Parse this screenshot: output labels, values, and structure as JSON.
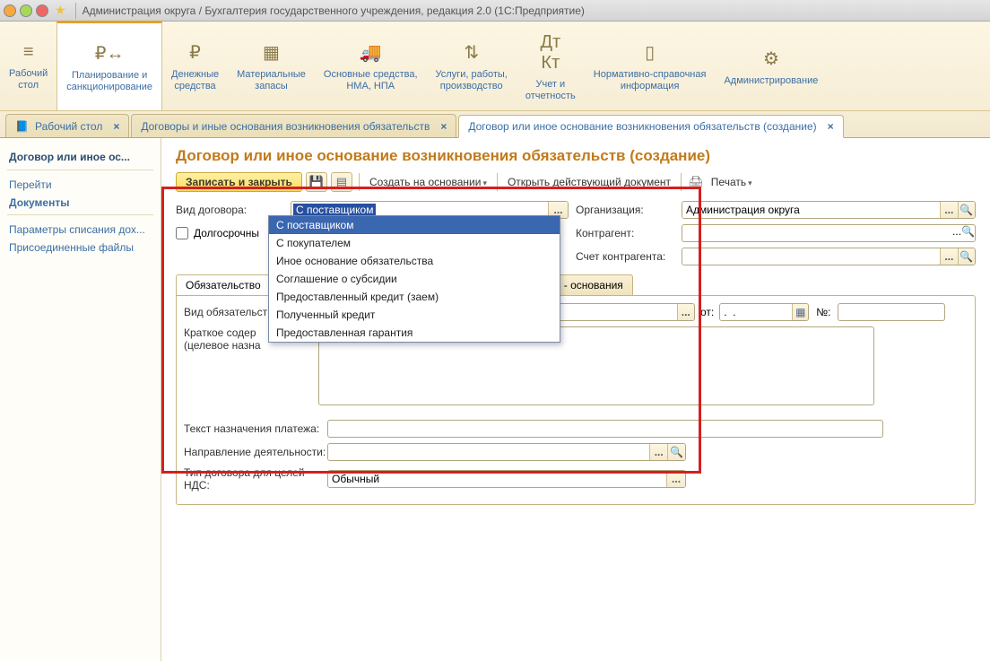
{
  "window": {
    "title": "Администрация округа / Бухгалтерия государственного учреждения, редакция 2.0  (1С:Предприятие)"
  },
  "toolbar": {
    "items": [
      {
        "label": "Рабочий\nстол"
      },
      {
        "label": "Планирование и\nсанкционирование"
      },
      {
        "label": "Денежные\nсредства"
      },
      {
        "label": "Материальные\nзапасы"
      },
      {
        "label": "Основные средства,\nНМА, НПА"
      },
      {
        "label": "Услуги, работы,\nпроизводство"
      },
      {
        "label": "Учет и\nотчетность"
      },
      {
        "label": "Нормативно-справочная\nинформация"
      },
      {
        "label": "Администрирование"
      }
    ]
  },
  "tabs": {
    "t0": "Рабочий стол",
    "t1": "Договоры и иные основания возникновения обязательств",
    "t2": "Договор или иное основание возникновения обязательств (создание)"
  },
  "sidebar": {
    "group_title": "Договор или иное ос...",
    "nav_goto": "Перейти",
    "nav_docs": "Документы",
    "link1": "Параметры списания дох...",
    "link2": "Присоединенные файлы"
  },
  "page": {
    "title": "Договор или иное основание возникновения обязательств (создание)",
    "actions": {
      "save_close": "Записать и закрыть",
      "create_based": "Создать на основании",
      "open_current": "Открыть действующий документ",
      "print": "Печать"
    },
    "form": {
      "contract_type_label": "Вид договора:",
      "contract_type_value": "С поставщиком",
      "dropdown": {
        "o0": "С поставщиком",
        "o1": "С покупателем",
        "o2": "Иное основание обязательства",
        "o3": "Соглашение о субсидии",
        "o4": "Предоставленный кредит (заем)",
        "o5": "Полученный кредит",
        "o6": "Предоставленная гарантия"
      },
      "long_term_label": "Долгосрочны",
      "organization_label": "Организация:",
      "organization_value": "Администрация округа",
      "contractor_label": "Контрагент:",
      "contractor_account_label": "Счет контрагента:",
      "obligation_tabs": {
        "t0": "Обязательство",
        "t1": "нты - основания"
      },
      "obligation_type_label": "Вид обязательст",
      "from_label": "от:",
      "date_value": ".  .",
      "number_label": "№:",
      "brief_label1": "Краткое содер",
      "brief_label2": "(целевое назна",
      "payment_text_label": "Текст назначения платежа:",
      "activity_direction_label": "Направление деятельности:",
      "vat_type_label": "Тип договора для целей НДС:",
      "vat_type_value": "Обычный"
    }
  }
}
